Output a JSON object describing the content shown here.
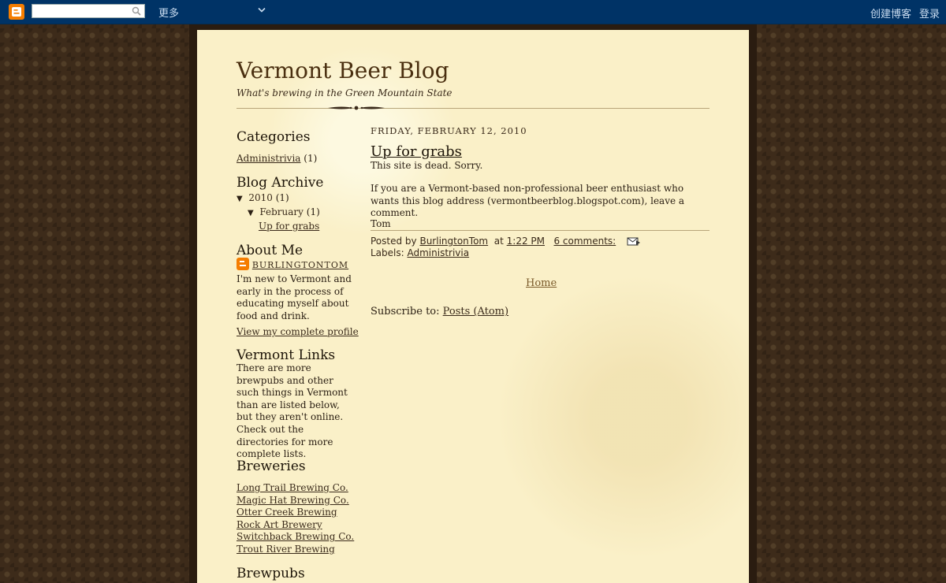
{
  "navbar": {
    "more_label": "更多",
    "create_blog": "创建博客",
    "login": "登录",
    "search_placeholder": ""
  },
  "header": {
    "title": "Vermont Beer Blog",
    "description": "What's brewing in the Green Mountain State"
  },
  "sidebar": {
    "categories": {
      "heading": "Categories",
      "items": [
        {
          "label": "Administrivia",
          "count": "(1)"
        }
      ]
    },
    "archive": {
      "heading": "Blog Archive",
      "year": "2010",
      "year_count": "(1)",
      "month": "February",
      "month_count": "(1)",
      "post": "Up for grabs",
      "arrow": "▼"
    },
    "about": {
      "heading": "About Me",
      "name": "BURLINGTONTOM",
      "bio": "I'm new to Vermont and early in the process of educating myself about food and drink.",
      "profile_link": "View my complete profile"
    },
    "vermont_links": {
      "heading": "Vermont Links",
      "text": "There are more brewpubs and other such things in Vermont than are listed below, but they aren't online. Check out the directories for more complete lists."
    },
    "breweries": {
      "heading": "Breweries",
      "items": [
        "Long Trail Brewing Co.",
        "Magic Hat Brewing Co.",
        "Otter Creek Brewing",
        "Rock Art Brewery",
        "Switchback Brewing Co.",
        "Trout River Brewing"
      ]
    },
    "brewpubs": {
      "heading": "Brewpubs"
    }
  },
  "post": {
    "date": "FRIDAY, FEBRUARY 12, 2010",
    "title": "Up for grabs",
    "body1": "This site is dead. Sorry.",
    "body2": "If you are a Vermont-based non-professional beer enthusiast who wants this blog address (vermontbeerblog.blogspot.com), leave a comment.",
    "signature": "Tom",
    "posted_by_label": "Posted by",
    "author": "BurlingtonTom",
    "at_label": "at",
    "time": "1:22 PM",
    "comments": "6 comments:",
    "labels_label": "Labels:",
    "label": "Administrivia"
  },
  "footer": {
    "home": "Home",
    "subscribe_label": "Subscribe to:",
    "subscribe_link": "Posts (Atom)"
  },
  "colors": {
    "navbar": "#003366",
    "page": "#faf0c8",
    "background": "#3d2b1a",
    "logo": "#f57d00"
  }
}
